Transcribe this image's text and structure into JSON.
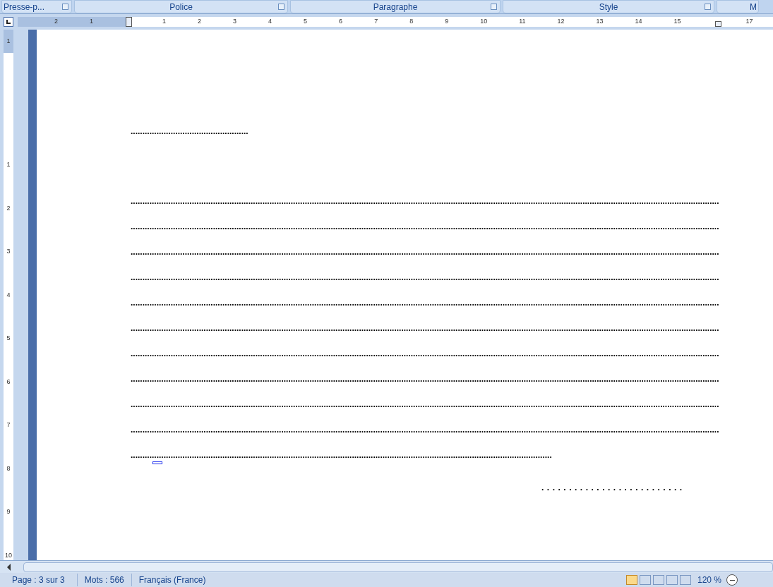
{
  "ribbon_groups": [
    {
      "label": "Presse-p...",
      "launcher": true
    },
    {
      "label": "Police",
      "launcher": true
    },
    {
      "label": "Paragraphe",
      "launcher": true
    },
    {
      "label": "Style",
      "launcher": true
    },
    {
      "label": "M",
      "launcher": false
    }
  ],
  "horizontal_ruler": {
    "ticks": [
      "2",
      "1",
      "1",
      "2",
      "3",
      "4",
      "5",
      "6",
      "7",
      "8",
      "9",
      "10",
      "11",
      "12",
      "13",
      "14",
      "15",
      "17"
    ]
  },
  "vertical_ruler": {
    "ticks": [
      "1",
      "1",
      "2",
      "3",
      "4",
      "5",
      "6",
      "7",
      "8",
      "9",
      "10"
    ]
  },
  "document": {
    "lines": [
      {
        "kind": "short",
        "text": ".................................................."
      },
      {
        "kind": "full",
        "text": ".........................................................................................................................................................................................................................................................."
      },
      {
        "kind": "full",
        "text": ".........................................................................................................................................................................................................................................................."
      },
      {
        "kind": "full",
        "text": ".........................................................................................................................................................................................................................................................."
      },
      {
        "kind": "full",
        "text": ".........................................................................................................................................................................................................................................................."
      },
      {
        "kind": "full",
        "text": ".........................................................................................................................................................................................................................................................."
      },
      {
        "kind": "full",
        "text": ".........................................................................................................................................................................................................................................................."
      },
      {
        "kind": "full",
        "text": ".........................................................................................................................................................................................................................................................."
      },
      {
        "kind": "full",
        "text": ".........................................................................................................................................................................................................................................................."
      },
      {
        "kind": "full",
        "text": ".........................................................................................................................................................................................................................................................."
      },
      {
        "kind": "full",
        "text": ".........................................................................................................................................................................................................................................................."
      },
      {
        "kind": "full",
        "text": "..................................................................................................................................................................................."
      },
      {
        "kind": "signature",
        "text": ".........................."
      }
    ]
  },
  "status_bar": {
    "page": "Page : 3 sur 3",
    "words": "Mots : 566",
    "language": "Français (France)",
    "zoom": "120 %"
  }
}
